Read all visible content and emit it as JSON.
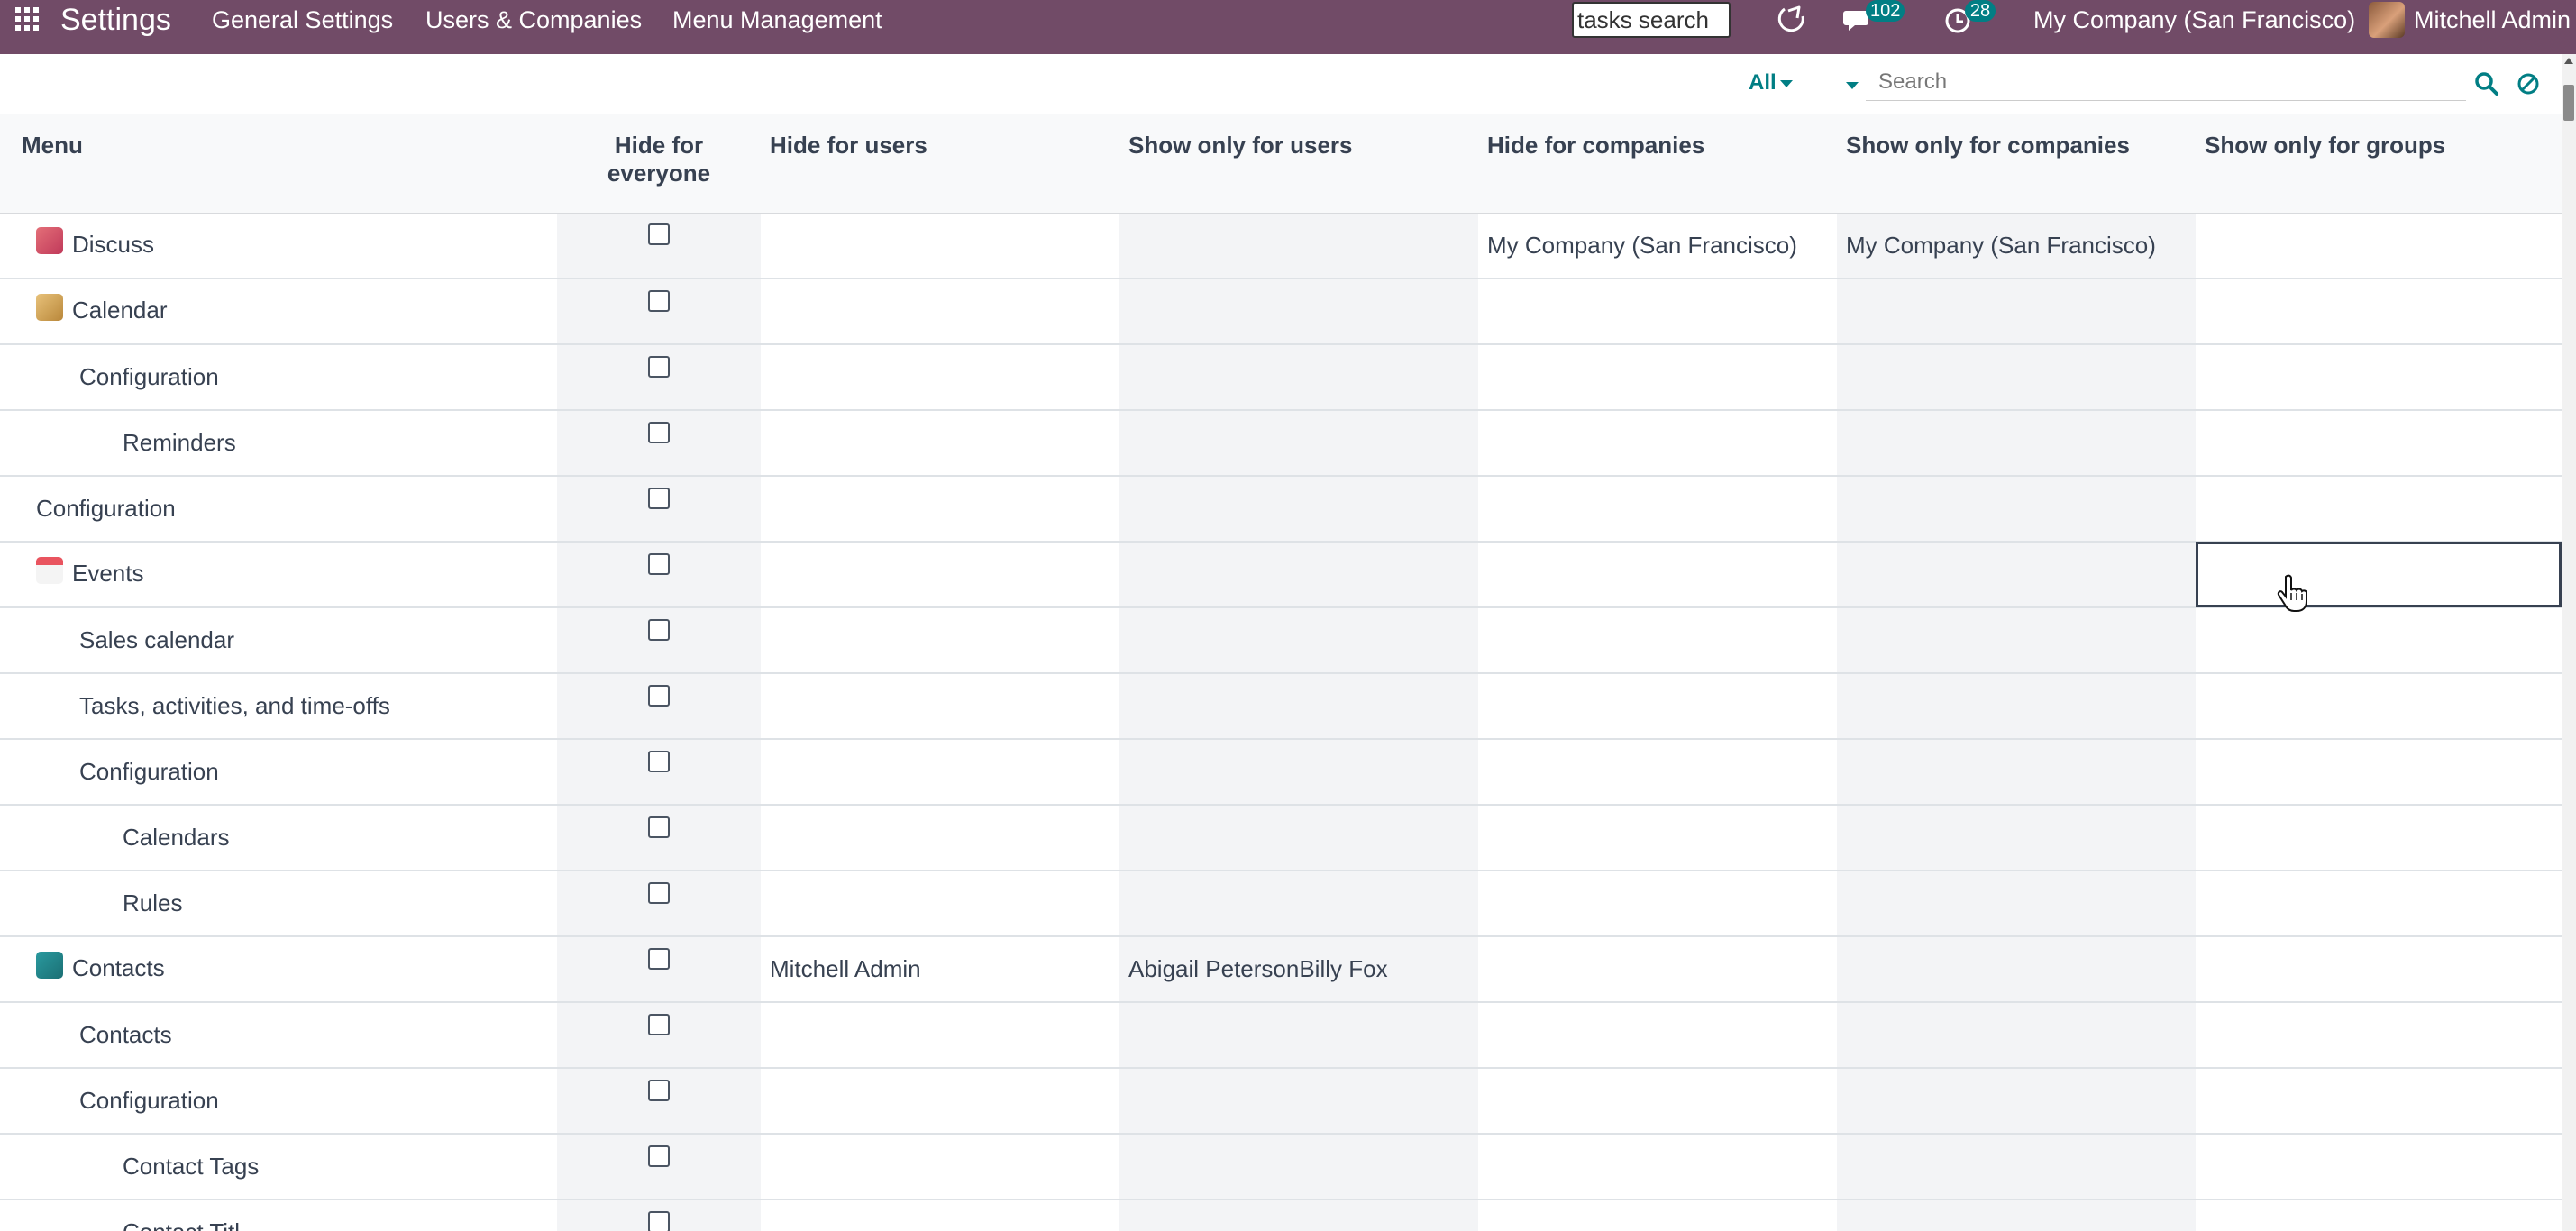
{
  "navbar": {
    "app_title": "Settings",
    "menus": [
      "General Settings",
      "Users & Companies",
      "Menu Management"
    ],
    "tasks_search_value": "tasks search",
    "messages_count": "102",
    "activities_count": "28",
    "company": "My Company (San Francisco)",
    "user": "Mitchell Admin",
    "bg_color": "#714b67"
  },
  "control": {
    "filter_label": "All",
    "search_placeholder": "Search",
    "accent_color": "#017e84"
  },
  "table": {
    "columns": [
      "Menu",
      "Hide for everyone",
      "Hide for users",
      "Show only for users",
      "Hide for companies",
      "Show only for companies",
      "Show only for groups"
    ],
    "rows": [
      {
        "menu": "Discuss",
        "icon": "discuss-icon",
        "hide_users": "",
        "show_users": "",
        "hide_companies": "My Company (San Francisco)",
        "show_companies": "My Company (San Francisco)",
        "show_groups": ""
      },
      {
        "menu": "Calendar",
        "icon": "calendar-app-icon",
        "hide_users": "",
        "show_users": "",
        "hide_companies": "",
        "show_companies": "",
        "show_groups": ""
      },
      {
        "menu": "Configuration",
        "icon": "",
        "hide_users": "",
        "show_users": "",
        "hide_companies": "",
        "show_companies": "",
        "show_groups": ""
      },
      {
        "menu": "Reminders",
        "icon": "",
        "hide_users": "",
        "show_users": "",
        "hide_companies": "",
        "show_companies": "",
        "show_groups": ""
      },
      {
        "menu": "Configuration",
        "icon": "",
        "hide_users": "",
        "show_users": "",
        "hide_companies": "",
        "show_companies": "",
        "show_groups": ""
      },
      {
        "menu": "Events",
        "icon": "events-icon",
        "hide_users": "",
        "show_users": "",
        "hide_companies": "",
        "show_companies": "",
        "show_groups": ""
      },
      {
        "menu": "Sales calendar",
        "icon": "",
        "hide_users": "",
        "show_users": "",
        "hide_companies": "",
        "show_companies": "",
        "show_groups": ""
      },
      {
        "menu": "Tasks, activities, and time-offs",
        "icon": "",
        "hide_users": "",
        "show_users": "",
        "hide_companies": "",
        "show_companies": "",
        "show_groups": ""
      },
      {
        "menu": "Configuration",
        "icon": "",
        "hide_users": "",
        "show_users": "",
        "hide_companies": "",
        "show_companies": "",
        "show_groups": ""
      },
      {
        "menu": "Calendars",
        "icon": "",
        "hide_users": "",
        "show_users": "",
        "hide_companies": "",
        "show_companies": "",
        "show_groups": ""
      },
      {
        "menu": "Rules",
        "icon": "",
        "hide_users": "",
        "show_users": "",
        "hide_companies": "",
        "show_companies": "",
        "show_groups": ""
      },
      {
        "menu": "Contacts",
        "icon": "contacts-icon",
        "hide_users": "Mitchell Admin",
        "show_users": "Abigail PetersonBilly Fox",
        "hide_companies": "",
        "show_companies": "",
        "show_groups": ""
      },
      {
        "menu": "Contacts",
        "icon": "",
        "hide_users": "",
        "show_users": "",
        "hide_companies": "",
        "show_companies": "",
        "show_groups": ""
      },
      {
        "menu": "Configuration",
        "icon": "",
        "hide_users": "",
        "show_users": "",
        "hide_companies": "",
        "show_companies": "",
        "show_groups": ""
      },
      {
        "menu": "Contact Tags",
        "icon": "",
        "hide_users": "",
        "show_users": "",
        "hide_companies": "",
        "show_companies": "",
        "show_groups": ""
      },
      {
        "menu": "Contact Titl",
        "icon": "",
        "hide_users": "",
        "show_users": "",
        "hide_companies": "",
        "show_companies": "",
        "show_groups": ""
      }
    ]
  }
}
